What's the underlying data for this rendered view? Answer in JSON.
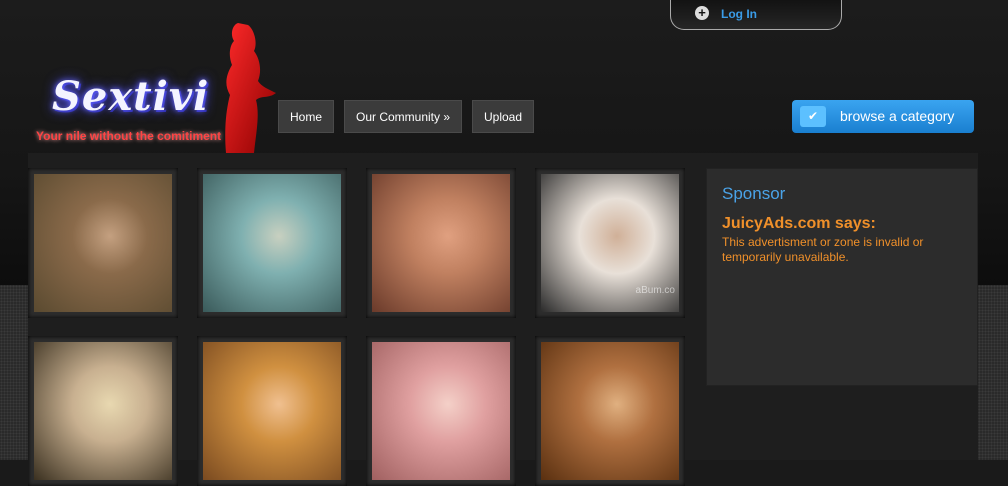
{
  "header": {
    "login_label": "Log In",
    "logo_text": "Sextivi",
    "tagline": "Your nile without the comitiment"
  },
  "nav": {
    "items": [
      "Home",
      "Our Community »",
      "Upload"
    ]
  },
  "browse_button": {
    "label": "browse a category"
  },
  "thumbnails": [
    {
      "name": "video-thumbnail-1",
      "colors": [
        "#8a6a4a",
        "#c4a080",
        "#5a4a30"
      ]
    },
    {
      "name": "video-thumbnail-2",
      "colors": [
        "#7fb0b0",
        "#c8d0c0",
        "#3a5a5a"
      ]
    },
    {
      "name": "video-thumbnail-3",
      "colors": [
        "#c08060",
        "#e0a080",
        "#6a3a2a"
      ]
    },
    {
      "name": "video-thumbnail-4",
      "colors": [
        "#e8e0d8",
        "#d0b098",
        "#2a2a2a"
      ],
      "watermark": "aBum.co"
    },
    {
      "name": "video-thumbnail-5",
      "colors": [
        "#c8b090",
        "#e8d8b0",
        "#3a3020"
      ]
    },
    {
      "name": "video-thumbnail-6",
      "colors": [
        "#d09040",
        "#f0c090",
        "#7a4a20"
      ]
    },
    {
      "name": "video-thumbnail-7",
      "colors": [
        "#e0a0a0",
        "#f4d0c8",
        "#a06060"
      ]
    },
    {
      "name": "video-thumbnail-8",
      "colors": [
        "#b07040",
        "#e0b080",
        "#5a3010"
      ]
    }
  ],
  "sponsor": {
    "title": "Sponsor",
    "says": "JuicyAds.com says:",
    "message": "This advertisment or zone is invalid or temporarily unavailable."
  }
}
